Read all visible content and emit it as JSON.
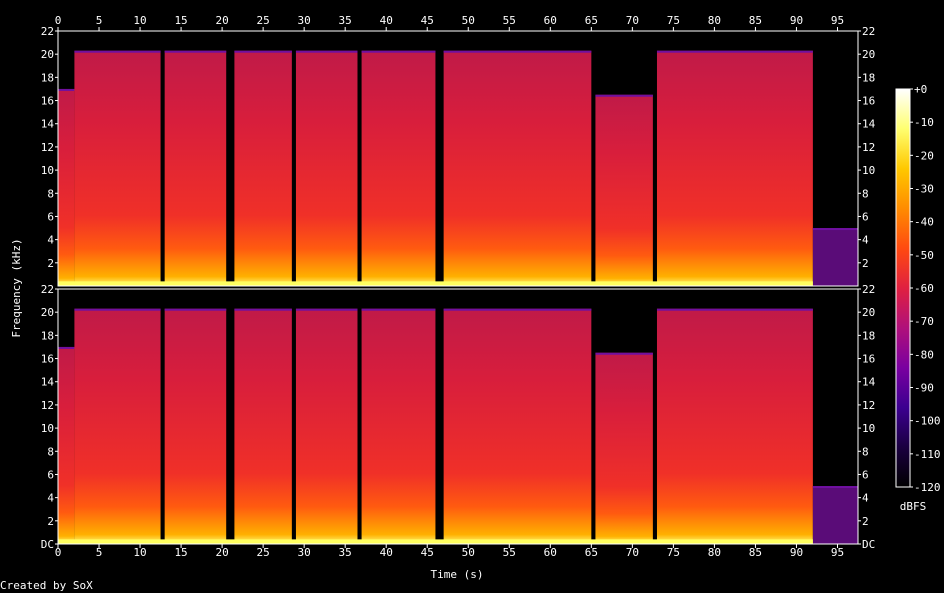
{
  "credit": "Created by SoX",
  "chart_data": {
    "type": "heatmap",
    "title": "",
    "xlabel": "Time (s)",
    "ylabel": "Frequency (kHz)",
    "xlim": [
      0,
      97.5
    ],
    "ylim": [
      0,
      22
    ],
    "x_ticks": [
      "0",
      "5",
      "10",
      "15",
      "20",
      "25",
      "30",
      "35",
      "40",
      "45",
      "50",
      "55",
      "60",
      "65",
      "70",
      "75",
      "80",
      "85",
      "90",
      "95"
    ],
    "y_ticks": [
      "DC",
      "2",
      "4",
      "6",
      "8",
      "10",
      "12",
      "14",
      "16",
      "18",
      "20",
      "22"
    ],
    "channels": 2,
    "colorbar": {
      "label": "dBFS",
      "ticks": [
        "+0",
        "-10",
        "-20",
        "-30",
        "-40",
        "-50",
        "-60",
        "-70",
        "-80",
        "-90",
        "-100",
        "-110",
        "-120"
      ],
      "range": [
        -120,
        0
      ],
      "colors": [
        "#000000",
        "#1a0040",
        "#3c0090",
        "#7a00a0",
        "#b0107a",
        "#e02040",
        "#ff4a10",
        "#ff8c00",
        "#ffc800",
        "#ffff70",
        "#ffffff"
      ]
    },
    "segments": [
      {
        "start": 0,
        "end": 2,
        "top_khz": 17
      },
      {
        "start": 2,
        "end": 12.5,
        "top_khz": 20.3
      },
      {
        "start": 13,
        "end": 20.5,
        "top_khz": 20.3
      },
      {
        "start": 21.5,
        "end": 28.5,
        "top_khz": 20.3
      },
      {
        "start": 29,
        "end": 36.5,
        "top_khz": 20.3
      },
      {
        "start": 37,
        "end": 46,
        "top_khz": 20.3
      },
      {
        "start": 47,
        "end": 65,
        "top_khz": 20.3
      },
      {
        "start": 65.5,
        "end": 72.5,
        "top_khz": 16.5
      },
      {
        "start": 73,
        "end": 92,
        "top_khz": 20.3
      },
      {
        "start": 92,
        "end": 97.5,
        "top_khz": 5
      }
    ]
  }
}
